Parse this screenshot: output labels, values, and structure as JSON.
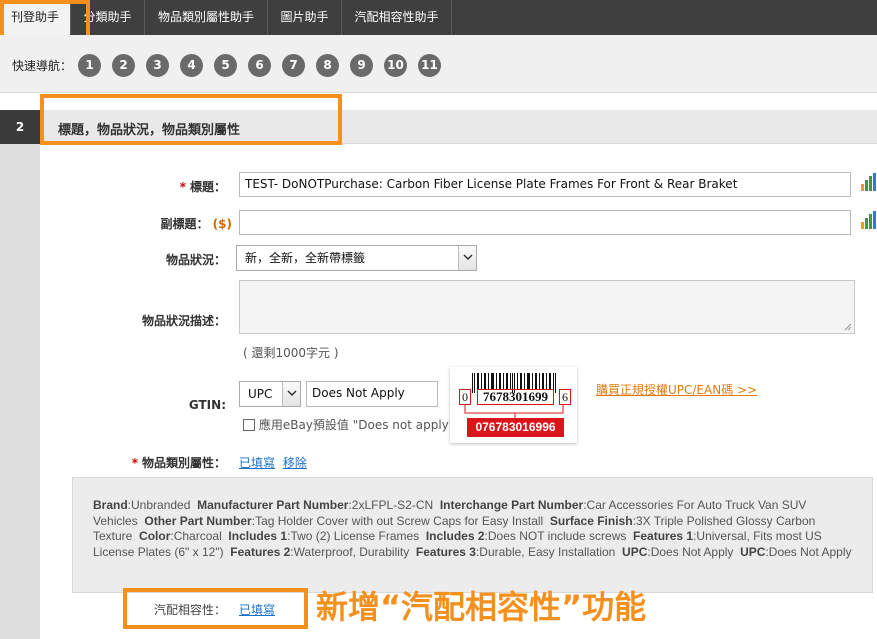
{
  "tabs": [
    "刊登助手",
    "分類助手",
    "物品類別屬性助手",
    "圖片助手",
    "汽配相容性助手"
  ],
  "quicknav": {
    "label": "快速導航：",
    "items": [
      "1",
      "2",
      "3",
      "4",
      "5",
      "6",
      "7",
      "8",
      "9",
      "10",
      "11"
    ]
  },
  "section": {
    "step": "2",
    "title": "標題，物品狀況，物品類別屬性"
  },
  "form": {
    "title_label": "標題：",
    "title_required": "*",
    "title_value": "TEST- DoNOTPurchase: Carbon Fiber License Plate Frames For Front & Rear Braket",
    "subtitle_label": "副標題：",
    "subtitle_price": "($)",
    "subtitle_value": "",
    "condition_label": "物品狀況：",
    "condition_value": "新，全新，全新帶標籤",
    "condition_desc_label": "物品狀況描述：",
    "remaining": "( 還剩1000字元 )",
    "gtin_label": "GTIN:",
    "gtin_type": "UPC",
    "gtin_value": "Does Not Apply",
    "ebay_default_label": "應用eBay預設值 \"Does not apply\"",
    "buy_link": "購買正規授權UPC/EAN碼 >>",
    "attr_label": "物品類別屬性：",
    "attr_required": "*",
    "attr_filled": "已填寫",
    "attr_remove": "移除",
    "compat_label": "汽配相容性：",
    "compat_filled": "已填寫"
  },
  "barcode": {
    "left_digit": "0",
    "middle_digits": "7678301699",
    "right_digit": "6",
    "full_code": "076783016996"
  },
  "specs": [
    {
      "k": "Brand",
      "v": "Unbranded"
    },
    {
      "k": "Manufacturer Part Number",
      "v": "2xLFPL-S2-CN"
    },
    {
      "k": "Interchange Part Number",
      "v": "Car Accessories For Auto Truck Van SUV Vehicles"
    },
    {
      "k": "Other Part Number",
      "v": "Tag Holder Cover with out Screw Caps for Easy Install"
    },
    {
      "k": "Surface Finish",
      "v": "3X Triple Polished Glossy Carbon Texture"
    },
    {
      "k": "Color",
      "v": "Charcoal"
    },
    {
      "k": "Includes 1",
      "v": "Two (2) License Frames"
    },
    {
      "k": "Includes 2",
      "v": "Does NOT include screws"
    },
    {
      "k": "Features 1",
      "v": "Universal, Fits most US License Plates (6\" x 12\")"
    },
    {
      "k": "Features 2",
      "v": "Waterproof, Durability"
    },
    {
      "k": "Features 3",
      "v": "Durable, Easy Installation"
    },
    {
      "k": "UPC",
      "v": "Does Not Apply"
    },
    {
      "k": "UPC",
      "v": "Does Not Apply"
    }
  ],
  "caption": "新增“汽配相容性”功能",
  "colors": {
    "highlight": "#f5901e",
    "tabbar": "#3f3f3f",
    "link": "#1a6fc9",
    "barcode_red": "#d9151b"
  }
}
